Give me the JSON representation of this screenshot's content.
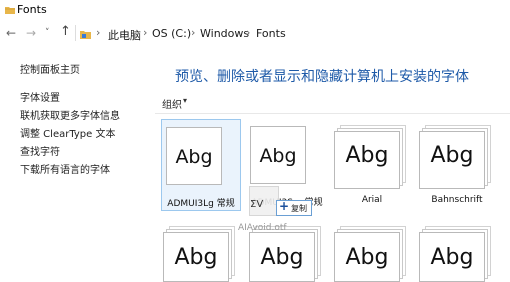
{
  "window": {
    "title": "Fonts"
  },
  "nav": {
    "back_icon": "←",
    "forward_icon": "→",
    "history_icon": "˅",
    "up_icon": "↑",
    "breadcrumb": [
      "此电脑",
      "OS (C:)",
      "Windows",
      "Fonts"
    ],
    "separator": "›"
  },
  "sidebar": {
    "home": "控制面板主页",
    "links": [
      "字体设置",
      "联机获取更多字体信息",
      "调整 ClearType 文本",
      "查找字符",
      "下载所有语言的字体"
    ]
  },
  "main": {
    "title": "预览、删除或者显示和隐藏计算机上安装的字体",
    "organize": "组织",
    "organize_caret": "▾"
  },
  "fonts": [
    {
      "sample": "Abg",
      "name": "ADMUI3Lg 常规"
    },
    {
      "sample": "Abg",
      "name": "ADMUI3Sm 常规"
    },
    {
      "sample": "Abg",
      "name": "Arial"
    },
    {
      "sample": "Abg",
      "name": "Bahnschrift"
    },
    {
      "sample": "Abg",
      "name": ""
    },
    {
      "sample": "Abg",
      "name": ""
    },
    {
      "sample": "Abg",
      "name": ""
    },
    {
      "sample": "Abg",
      "name": ""
    }
  ],
  "drag": {
    "ghost_glyph": "ΣV",
    "plus": "+",
    "action": "复制",
    "file": "AIAvoid.otf"
  },
  "colors": {
    "title_blue": "#1e5aa8",
    "folder_yellow": "#e8b64a",
    "selection_bg": "#eaf3fc",
    "selection_border": "#9cc8ee"
  }
}
